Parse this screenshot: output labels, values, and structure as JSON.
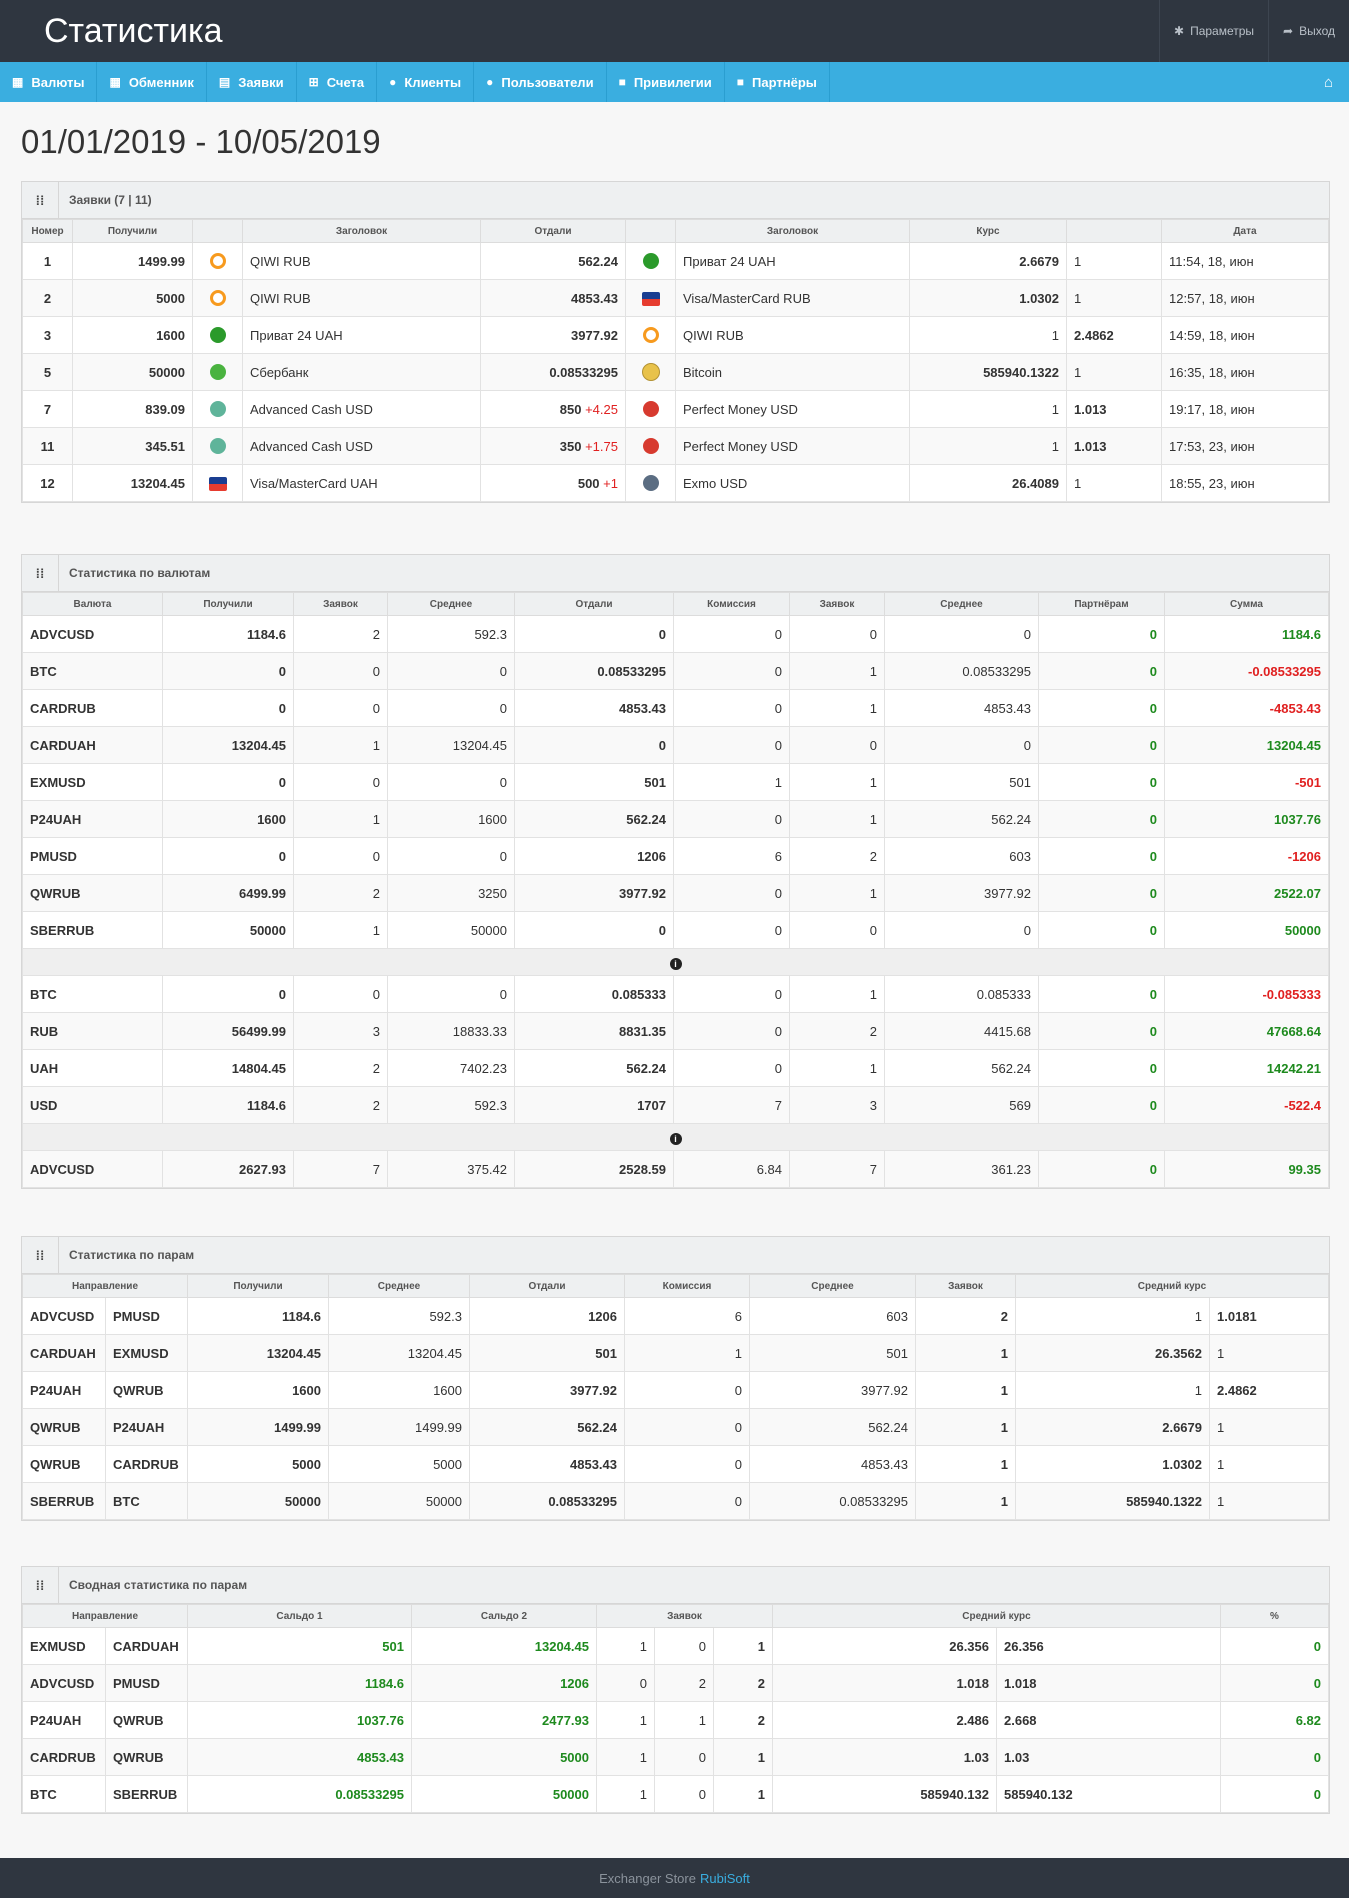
{
  "brand": "Статистика",
  "topnav": [
    {
      "icon": "gear-icon",
      "glyph": "✱",
      "label": "Параметры"
    },
    {
      "icon": "logout-icon",
      "glyph": "➦",
      "label": "Выход"
    }
  ],
  "menu": [
    {
      "icon": "grid-icon",
      "glyph": "▦",
      "label": "Валюты"
    },
    {
      "icon": "exchange-icon",
      "glyph": "▦",
      "label": "Обменник"
    },
    {
      "icon": "orders-icon",
      "glyph": "▤",
      "label": "Заявки"
    },
    {
      "icon": "cart-icon",
      "glyph": "⊞",
      "label": "Счета"
    },
    {
      "icon": "info-icon",
      "glyph": "●",
      "label": "Клиенты"
    },
    {
      "icon": "user-icon",
      "glyph": "●",
      "label": "Пользователи"
    },
    {
      "icon": "lock-icon",
      "glyph": "■",
      "label": "Привилегии"
    },
    {
      "icon": "briefcase-icon",
      "glyph": "■",
      "label": "Партнёры"
    }
  ],
  "date_range": "01/01/2019 - 10/05/2019",
  "orders": {
    "title": "Заявки (7 | 11)",
    "headers": [
      "Номер",
      "Получили",
      "",
      "Заголовок",
      "Отдали",
      "",
      "Заголовок",
      "Курс",
      "",
      "Дата"
    ],
    "rows": [
      {
        "num": "1",
        "got": "1499.99",
        "icon_in": "qiwi",
        "title_in": "QIWI RUB",
        "gave": "562.24",
        "extra": "",
        "icon_out": "p24",
        "title_out": "Приват 24 UAH",
        "rate1": "2.6679",
        "rate2": "1",
        "date": "11:54, 18, июн",
        "r2b": false
      },
      {
        "num": "2",
        "got": "5000",
        "icon_in": "qiwi",
        "title_in": "QIWI RUB",
        "gave": "4853.43",
        "extra": "",
        "icon_out": "visa",
        "title_out": "Visa/MasterCard RUB",
        "rate1": "1.0302",
        "rate2": "1",
        "date": "12:57, 18, июн",
        "r2b": false
      },
      {
        "num": "3",
        "got": "1600",
        "icon_in": "p24",
        "title_in": "Приват 24 UAH",
        "gave": "3977.92",
        "extra": "",
        "icon_out": "qiwi",
        "title_out": "QIWI RUB",
        "rate1": "1",
        "rate2": "2.4862",
        "date": "14:59, 18, июн",
        "r2b": true
      },
      {
        "num": "5",
        "got": "50000",
        "icon_in": "sber",
        "title_in": "Сбербанк",
        "gave": "0.08533295",
        "extra": "",
        "icon_out": "btc",
        "title_out": "Bitcoin",
        "rate1": "585940.1322",
        "rate2": "1",
        "date": "16:35, 18, июн",
        "r2b": false
      },
      {
        "num": "7",
        "got": "839.09",
        "icon_in": "adv",
        "title_in": "Advanced Cash USD",
        "gave": "850",
        "extra": "+4.25",
        "icon_out": "pm",
        "title_out": "Perfect Money USD",
        "rate1": "1",
        "rate2": "1.013",
        "date": "19:17, 18, июн",
        "r2b": true
      },
      {
        "num": "11",
        "got": "345.51",
        "icon_in": "adv",
        "title_in": "Advanced Cash USD",
        "gave": "350",
        "extra": "+1.75",
        "icon_out": "pm",
        "title_out": "Perfect Money USD",
        "rate1": "1",
        "rate2": "1.013",
        "date": "17:53, 23, июн",
        "r2b": true
      },
      {
        "num": "12",
        "got": "13204.45",
        "icon_in": "visa",
        "title_in": "Visa/MasterCard UAH",
        "gave": "500",
        "extra": "+1",
        "icon_out": "exmo",
        "title_out": "Exmo USD",
        "rate1": "26.4089",
        "rate2": "1",
        "date": "18:55, 23, июн",
        "r2b": false
      }
    ]
  },
  "currencies": {
    "title": "Статистика по валютам",
    "headers": [
      "Валюта",
      "Получили",
      "Заявок",
      "Среднее",
      "Отдали",
      "Комиссия",
      "Заявок",
      "Среднее",
      "Партнёрам",
      "Сумма"
    ],
    "group1": [
      [
        "ADVCUSD",
        "1184.6",
        "2",
        "592.3",
        "0",
        "0",
        "0",
        "0",
        "0",
        "1184.6"
      ],
      [
        "BTC",
        "0",
        "0",
        "0",
        "0.08533295",
        "0",
        "1",
        "0.08533295",
        "0",
        "-0.08533295"
      ],
      [
        "CARDRUB",
        "0",
        "0",
        "0",
        "4853.43",
        "0",
        "1",
        "4853.43",
        "0",
        "-4853.43"
      ],
      [
        "CARDUAH",
        "13204.45",
        "1",
        "13204.45",
        "0",
        "0",
        "0",
        "0",
        "0",
        "13204.45"
      ],
      [
        "EXMUSD",
        "0",
        "0",
        "0",
        "501",
        "1",
        "1",
        "501",
        "0",
        "-501"
      ],
      [
        "P24UAH",
        "1600",
        "1",
        "1600",
        "562.24",
        "0",
        "1",
        "562.24",
        "0",
        "1037.76"
      ],
      [
        "PMUSD",
        "0",
        "0",
        "0",
        "1206",
        "6",
        "2",
        "603",
        "0",
        "-1206"
      ],
      [
        "QWRUB",
        "6499.99",
        "2",
        "3250",
        "3977.92",
        "0",
        "1",
        "3977.92",
        "0",
        "2522.07"
      ],
      [
        "SBERRUB",
        "50000",
        "1",
        "50000",
        "0",
        "0",
        "0",
        "0",
        "0",
        "50000"
      ]
    ],
    "group2": [
      [
        "BTC",
        "0",
        "0",
        "0",
        "0.085333",
        "0",
        "1",
        "0.085333",
        "0",
        "-0.085333"
      ],
      [
        "RUB",
        "56499.99",
        "3",
        "18833.33",
        "8831.35",
        "0",
        "2",
        "4415.68",
        "0",
        "47668.64"
      ],
      [
        "UAH",
        "14804.45",
        "2",
        "7402.23",
        "562.24",
        "0",
        "1",
        "562.24",
        "0",
        "14242.21"
      ],
      [
        "USD",
        "1184.6",
        "2",
        "592.3",
        "1707",
        "7",
        "3",
        "569",
        "0",
        "-522.4"
      ]
    ],
    "group3": [
      [
        "ADVCUSD",
        "2627.93",
        "7",
        "375.42",
        "2528.59",
        "6.84",
        "7",
        "361.23",
        "0",
        "99.35"
      ]
    ],
    "info_glyph": "i"
  },
  "pairs": {
    "title": "Статистика по парам",
    "headers": [
      "Направление",
      "Получили",
      "Среднее",
      "Отдали",
      "Комиссия",
      "Среднее",
      "Заявок",
      "Средний курс"
    ],
    "rows": [
      [
        "ADVCUSD",
        "PMUSD",
        "1184.6",
        "592.3",
        "1206",
        "6",
        "603",
        "2",
        "1",
        "1.0181"
      ],
      [
        "CARDUAH",
        "EXMUSD",
        "13204.45",
        "13204.45",
        "501",
        "1",
        "501",
        "1",
        "26.3562",
        "1"
      ],
      [
        "P24UAH",
        "QWRUB",
        "1600",
        "1600",
        "3977.92",
        "0",
        "3977.92",
        "1",
        "1",
        "2.4862"
      ],
      [
        "QWRUB",
        "P24UAH",
        "1499.99",
        "1499.99",
        "562.24",
        "0",
        "562.24",
        "1",
        "2.6679",
        "1"
      ],
      [
        "QWRUB",
        "CARDRUB",
        "5000",
        "5000",
        "4853.43",
        "0",
        "4853.43",
        "1",
        "1.0302",
        "1"
      ],
      [
        "SBERRUB",
        "BTC",
        "50000",
        "50000",
        "0.08533295",
        "0",
        "0.08533295",
        "1",
        "585940.1322",
        "1"
      ]
    ],
    "bold_rate_left": [
      false,
      true,
      false,
      true,
      true,
      true
    ],
    "bold_rate_right": [
      true,
      false,
      true,
      false,
      false,
      false
    ]
  },
  "summary": {
    "title": "Сводная статистика по парам",
    "headers": [
      "Направление",
      "Сальдо 1",
      "Сальдо 2",
      "Заявок",
      "Средний курс",
      "%"
    ],
    "rows": [
      [
        "EXMUSD",
        "CARDUAH",
        "501",
        "13204.45",
        "1",
        "0",
        "1",
        "26.356",
        "26.356",
        "0"
      ],
      [
        "ADVCUSD",
        "PMUSD",
        "1184.6",
        "1206",
        "0",
        "2",
        "2",
        "1.018",
        "1.018",
        "0"
      ],
      [
        "P24UAH",
        "QWRUB",
        "1037.76",
        "2477.93",
        "1",
        "1",
        "2",
        "2.486",
        "2.668",
        "6.82"
      ],
      [
        "CARDRUB",
        "QWRUB",
        "4853.43",
        "5000",
        "1",
        "0",
        "1",
        "1.03",
        "1.03",
        "0"
      ],
      [
        "BTC",
        "SBERRUB",
        "0.08533295",
        "50000",
        "1",
        "0",
        "1",
        "585940.132",
        "585940.132",
        "0"
      ]
    ]
  },
  "footer": {
    "text": "Exchanger Store",
    "link": "RubiSoft"
  },
  "colors": {
    "topbar": "#2f3640",
    "menubar": "#3aaee0",
    "positive": "#1e8a1e",
    "negative": "#e02020"
  }
}
